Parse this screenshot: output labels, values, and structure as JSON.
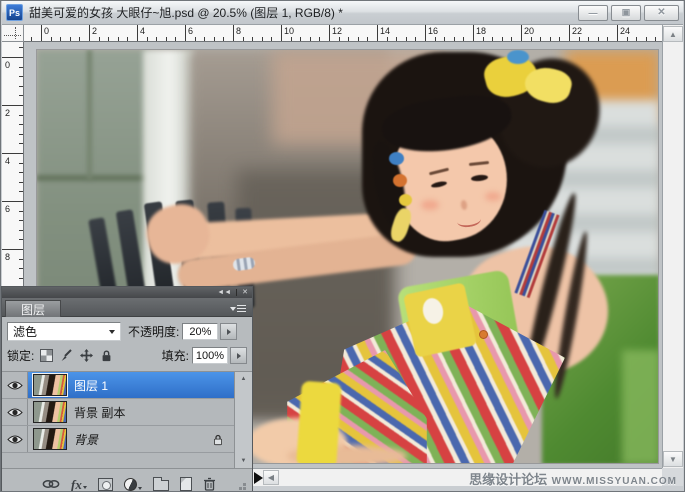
{
  "window": {
    "app_badge": "Ps",
    "title": "甜美可爱的女孩 大眼仔~旭.psd @ 20.5% (图层 1, RGB/8) *",
    "controls": {
      "minimize": "—",
      "restore": "▣",
      "close": "✕"
    }
  },
  "rulers": {
    "horizontal_labels": [
      "0",
      "2",
      "4",
      "6",
      "8",
      "10",
      "12",
      "14",
      "16",
      "18",
      "20",
      "22",
      "24"
    ],
    "vertical_labels": [
      "0",
      "2",
      "4",
      "6",
      "8"
    ]
  },
  "scrollbars": {
    "up": "▲",
    "down": "▼",
    "left": "◀"
  },
  "layers_panel": {
    "collapse_glyph": "◄◄",
    "close_glyph": "✕",
    "tab_label": "图层",
    "blend_mode": "滤色",
    "opacity_label": "不透明度:",
    "opacity_value": "20%",
    "lock_label": "锁定:",
    "fill_label": "填充:",
    "fill_value": "100%",
    "fx_label": "fx",
    "layers": [
      {
        "name": "图层 1",
        "selected": true,
        "locked": false
      },
      {
        "name": "背景 副本",
        "selected": false,
        "locked": false
      },
      {
        "name": "背景",
        "selected": false,
        "locked": true
      }
    ]
  },
  "watermark": {
    "site_name": "思缘设计论坛",
    "site_url": "WWW.MISSYUAN.COM"
  },
  "colors": {
    "selection_blue": "#3c82dc",
    "panel_gray": "#b7bbbe",
    "canvas_gray": "#bfc3c6"
  }
}
